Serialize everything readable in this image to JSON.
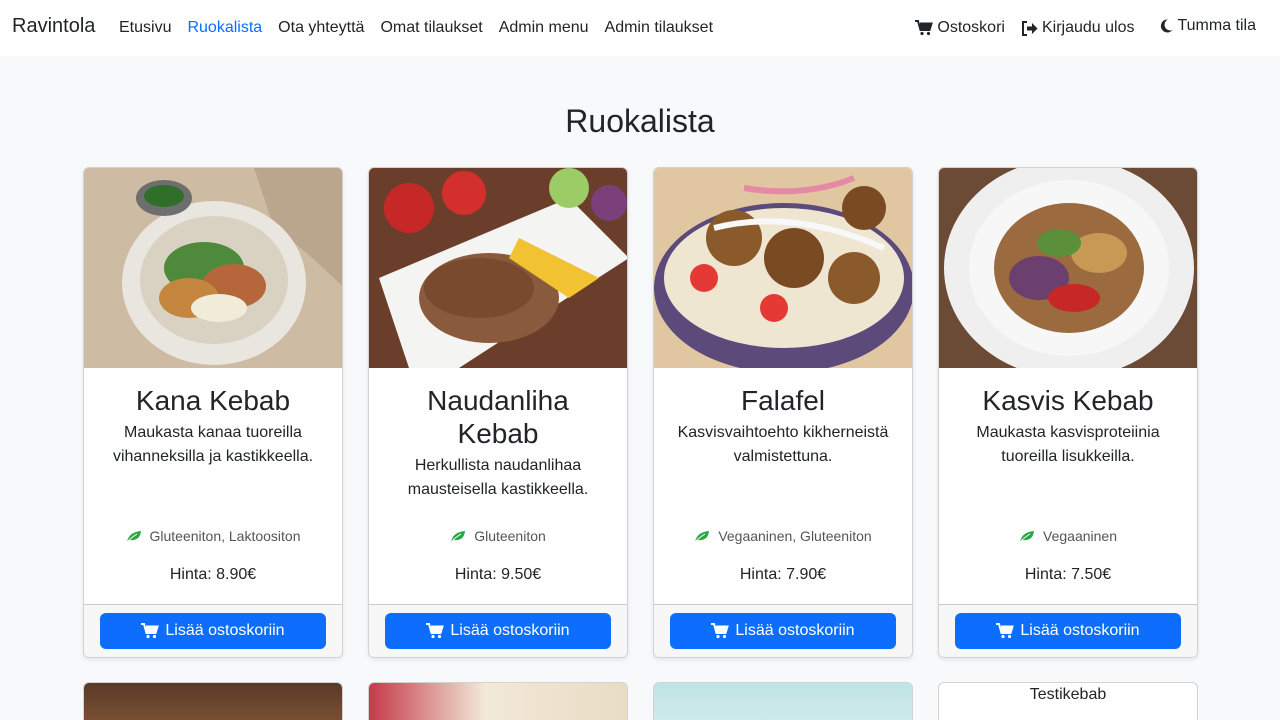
{
  "nav": {
    "brand": "Ravintola",
    "links": [
      "Etusivu",
      "Ruokalista",
      "Ota yhteyttä",
      "Omat tilaukset",
      "Admin menu",
      "Admin tilaukset"
    ],
    "cart": "Ostoskori",
    "logout": "Kirjaudu ulos",
    "theme": "Tumma tila",
    "active_color": "#0d6efd"
  },
  "page": {
    "title": "Ruokalista"
  },
  "menu": [
    {
      "name": "Kana Kebab",
      "description": "Maukasta kanaa tuoreilla vihanneksilla ja kastikkeella.",
      "diet": "Gluteeniton, Laktoositon",
      "price": "Hinta: 8.90€",
      "button": "Lisää ostoskoriin"
    },
    {
      "name": "Naudanliha Kebab",
      "description": "Herkullista naudanlihaa mausteisella kastikkeella.",
      "diet": "Gluteeniton",
      "price": "Hinta: 9.50€",
      "button": "Lisää ostoskoriin"
    },
    {
      "name": "Falafel",
      "description": "Kasvisvaihtoehto kikherneistä valmistettuna.",
      "diet": "Vegaaninen, Gluteeniton",
      "price": "Hinta: 7.90€",
      "button": "Lisää ostoskoriin"
    },
    {
      "name": "Kasvis Kebab",
      "description": "Maukasta kasvisproteiinia tuoreilla lisukkeilla.",
      "diet": "Vegaaninen",
      "price": "Hinta: 7.50€",
      "button": "Lisää ostoskoriin"
    }
  ],
  "second_row": {
    "testikebab": "Testikebab"
  },
  "colors": {
    "primary": "#0d6efd",
    "leaf": "#28a745",
    "background": "#f8f9fa"
  }
}
